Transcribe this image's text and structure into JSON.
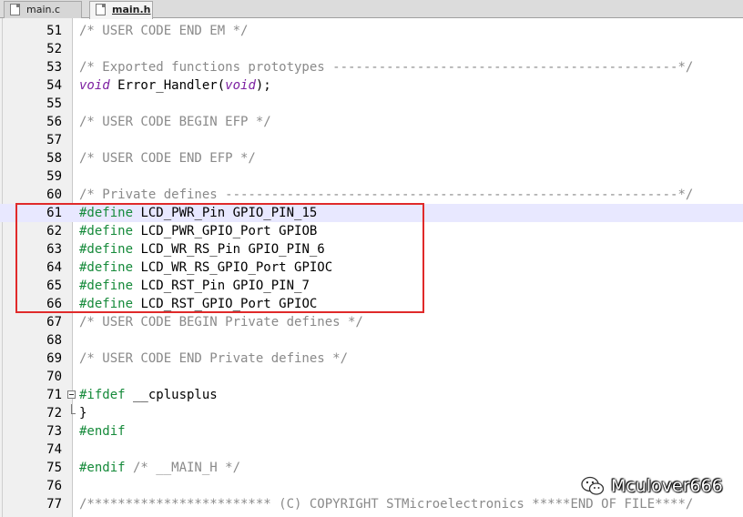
{
  "tabs": [
    {
      "label": "main.c",
      "active": false
    },
    {
      "label": "main.h",
      "active": true
    }
  ],
  "lines": [
    {
      "num": "51",
      "tokens": [
        {
          "t": "cm",
          "v": "/* USER CODE END EM */"
        }
      ]
    },
    {
      "num": "52",
      "tokens": []
    },
    {
      "num": "53",
      "tokens": [
        {
          "t": "cm",
          "v": "/* Exported functions prototypes ---------------------------------------------*/"
        }
      ]
    },
    {
      "num": "54",
      "tokens": [
        {
          "t": "kw",
          "v": "void"
        },
        {
          "t": "tx",
          "v": " Error_Handler("
        },
        {
          "t": "kw",
          "v": "void"
        },
        {
          "t": "tx",
          "v": ");"
        }
      ]
    },
    {
      "num": "55",
      "tokens": []
    },
    {
      "num": "56",
      "tokens": [
        {
          "t": "cm",
          "v": "/* USER CODE BEGIN EFP */"
        }
      ]
    },
    {
      "num": "57",
      "tokens": []
    },
    {
      "num": "58",
      "tokens": [
        {
          "t": "cm",
          "v": "/* USER CODE END EFP */"
        }
      ]
    },
    {
      "num": "59",
      "tokens": []
    },
    {
      "num": "60",
      "tokens": [
        {
          "t": "cm",
          "v": "/* Private defines -----------------------------------------------------------*/"
        }
      ]
    },
    {
      "num": "61",
      "highlight": true,
      "tokens": [
        {
          "t": "pp",
          "v": "#define"
        },
        {
          "t": "tx",
          "v": " LCD_PWR_Pin GPIO_PIN_15"
        }
      ]
    },
    {
      "num": "62",
      "tokens": [
        {
          "t": "pp",
          "v": "#define"
        },
        {
          "t": "tx",
          "v": " LCD_PWR_GPIO_Port GPIOB"
        }
      ]
    },
    {
      "num": "63",
      "tokens": [
        {
          "t": "pp",
          "v": "#define"
        },
        {
          "t": "tx",
          "v": " LCD_WR_RS_Pin GPIO_PIN_6"
        }
      ]
    },
    {
      "num": "64",
      "tokens": [
        {
          "t": "pp",
          "v": "#define"
        },
        {
          "t": "tx",
          "v": " LCD_WR_RS_GPIO_Port GPIOC"
        }
      ]
    },
    {
      "num": "65",
      "tokens": [
        {
          "t": "pp",
          "v": "#define"
        },
        {
          "t": "tx",
          "v": " LCD_RST_Pin GPIO_PIN_7"
        }
      ]
    },
    {
      "num": "66",
      "tokens": [
        {
          "t": "pp",
          "v": "#define"
        },
        {
          "t": "tx",
          "v": " LCD_RST_GPIO_Port GPIOC"
        }
      ]
    },
    {
      "num": "67",
      "tokens": [
        {
          "t": "cm",
          "v": "/* USER CODE BEGIN Private defines */"
        }
      ]
    },
    {
      "num": "68",
      "tokens": []
    },
    {
      "num": "69",
      "tokens": [
        {
          "t": "cm",
          "v": "/* USER CODE END Private defines */"
        }
      ]
    },
    {
      "num": "70",
      "tokens": []
    },
    {
      "num": "71",
      "fold": "start",
      "tokens": [
        {
          "t": "pp",
          "v": "#ifdef"
        },
        {
          "t": "tx",
          "v": " __cplusplus"
        }
      ]
    },
    {
      "num": "72",
      "fold": "end",
      "tokens": [
        {
          "t": "tx",
          "v": "}"
        }
      ]
    },
    {
      "num": "73",
      "tokens": [
        {
          "t": "pp",
          "v": "#endif"
        }
      ]
    },
    {
      "num": "74",
      "tokens": []
    },
    {
      "num": "75",
      "tokens": [
        {
          "t": "pp",
          "v": "#endif"
        },
        {
          "t": "cm",
          "v": " /* __MAIN_H */"
        }
      ]
    },
    {
      "num": "76",
      "tokens": []
    },
    {
      "num": "77",
      "tokens": [
        {
          "t": "cm",
          "v": "/************************ (C) COPYRIGHT STMicroelectronics *****END OF FILE****/"
        }
      ]
    }
  ],
  "watermark": {
    "text": "Mculover666",
    "icon": "wechat-icon"
  },
  "colors": {
    "comment": "#8a8a8a",
    "keyword": "#7c1fa1",
    "preprocessor": "#158a3a",
    "highlight": "#e8e8ff",
    "annotation_box": "#e02a2a"
  }
}
